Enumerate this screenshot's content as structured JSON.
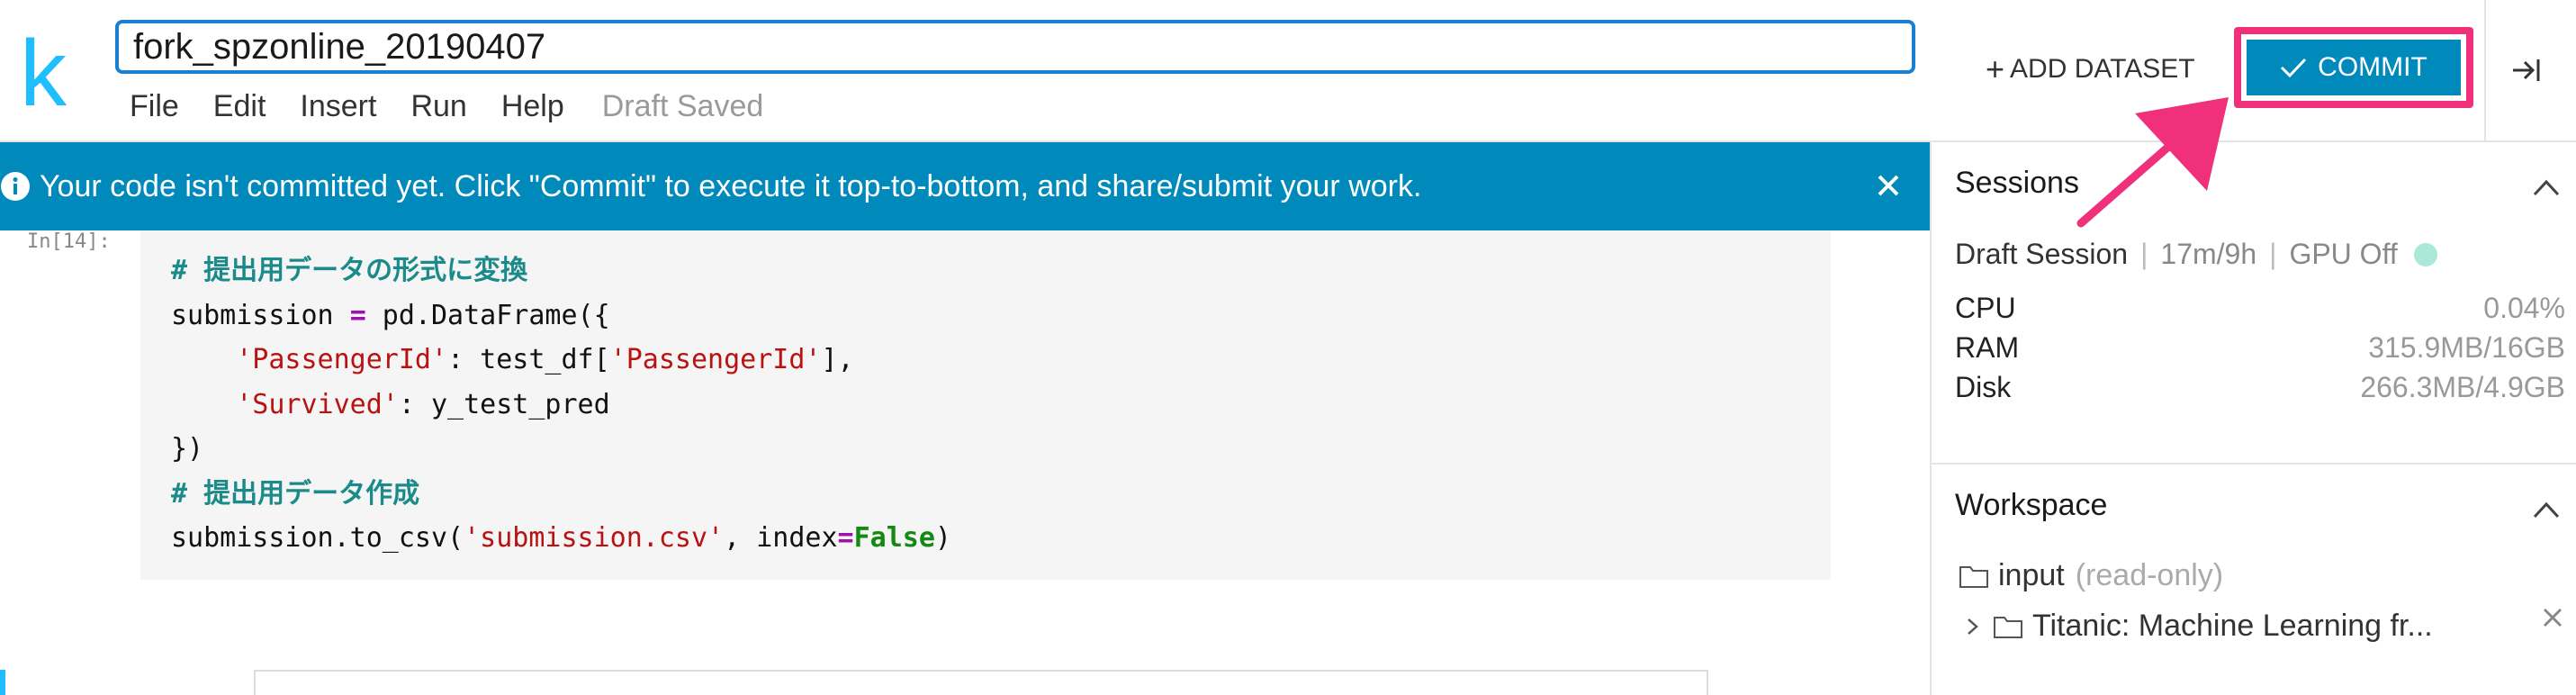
{
  "app": {
    "logo_letter": "k",
    "brand_color": "#20beff",
    "accent_color": "#008abc",
    "highlight_color": "#f0307a"
  },
  "header": {
    "notebook_title": "fork_spzonline_20190407",
    "menu": [
      "File",
      "Edit",
      "Insert",
      "Run",
      "Help"
    ],
    "status": "Draft Saved",
    "add_dataset_label": "ADD DATASET",
    "commit_label": "COMMIT"
  },
  "banner": {
    "text": "Your code isn't committed yet. Click \"Commit\" to execute it top-to-bottom, and share/submit your work."
  },
  "cell": {
    "prompt": "In[14]:",
    "lines": [
      [
        {
          "t": "# 提出用データの形式に変換",
          "c": "comment"
        }
      ],
      [
        {
          "t": "submission "
        },
        {
          "t": "=",
          "c": "op"
        },
        {
          "t": " pd.DataFrame({"
        }
      ],
      [
        {
          "t": "    "
        },
        {
          "t": "'PassengerId'",
          "c": "str"
        },
        {
          "t": ": test_df["
        },
        {
          "t": "'PassengerId'",
          "c": "str"
        },
        {
          "t": "],"
        }
      ],
      [
        {
          "t": "    "
        },
        {
          "t": "'Survived'",
          "c": "str"
        },
        {
          "t": ": y_test_pred"
        }
      ],
      [
        {
          "t": "})"
        }
      ],
      [
        {
          "t": "# 提出用データ作成",
          "c": "comment"
        }
      ],
      [
        {
          "t": "submission.to_csv("
        },
        {
          "t": "'submission.csv'",
          "c": "str"
        },
        {
          "t": ", index"
        },
        {
          "t": "=",
          "c": "op"
        },
        {
          "t": "False",
          "c": "kw"
        },
        {
          "t": ")"
        }
      ]
    ]
  },
  "sessions": {
    "title": "Sessions",
    "session_name": "Draft Session",
    "time": "17m/9h",
    "gpu": "GPU Off",
    "metrics": [
      {
        "label": "CPU",
        "value": "0.04%"
      },
      {
        "label": "RAM",
        "value": "315.9MB/16GB"
      },
      {
        "label": "Disk",
        "value": "266.3MB/4.9GB"
      }
    ]
  },
  "workspace": {
    "title": "Workspace",
    "input_label": "input",
    "input_note": "(read-only)",
    "dataset": "Titanic: Machine Learning fr..."
  }
}
